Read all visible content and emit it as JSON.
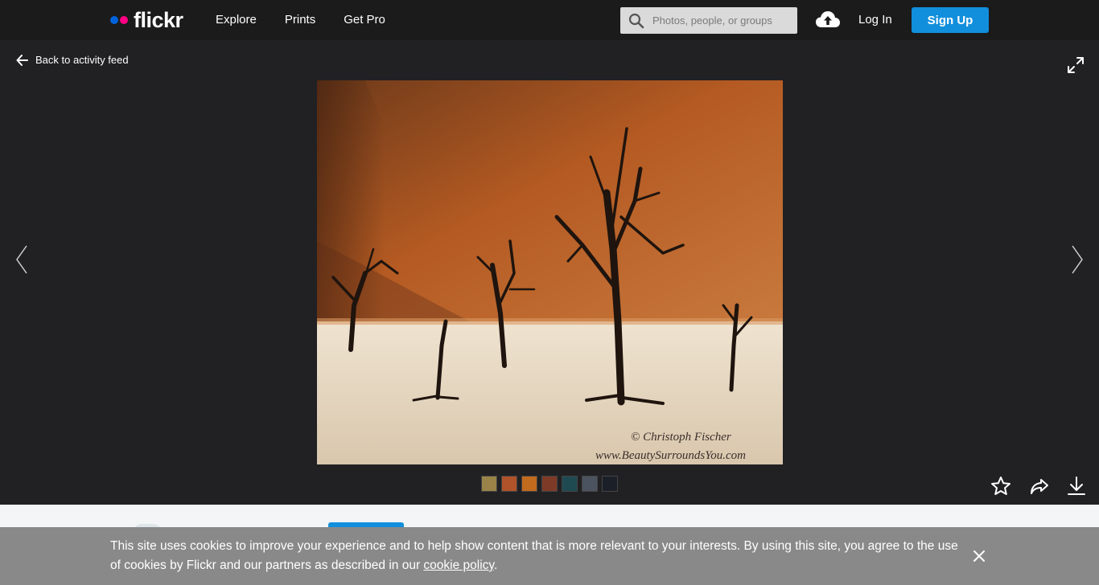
{
  "nav": {
    "logo_text": "flickr",
    "links": [
      "Explore",
      "Prints",
      "Get Pro"
    ],
    "search_placeholder": "Photos, people, or groups",
    "login_label": "Log In",
    "signup_label": "Sign Up"
  },
  "photo_view": {
    "back_label": "Back to activity feed",
    "watermark_line1": "© Christoph Fischer",
    "watermark_line2": "www.BeautySurroundsYou.com",
    "thumbnail_colors": [
      "#9a8348",
      "#b0522a",
      "#c26a1e",
      "#7d3a26",
      "#1f4a52",
      "#4c5360",
      "#1b1f27"
    ]
  },
  "cookie_banner": {
    "text_before_link": "This site uses cookies to improve your experience and to help show content that is more relevant to your interests. By using this site, you agree to the use of cookies by Flickr and our partners as described in our ",
    "link_text": "cookie policy",
    "text_after_link": "."
  },
  "colors": {
    "brand_blue": "#0063dc",
    "brand_pink": "#ff0084",
    "signup_button": "#128fdc"
  }
}
